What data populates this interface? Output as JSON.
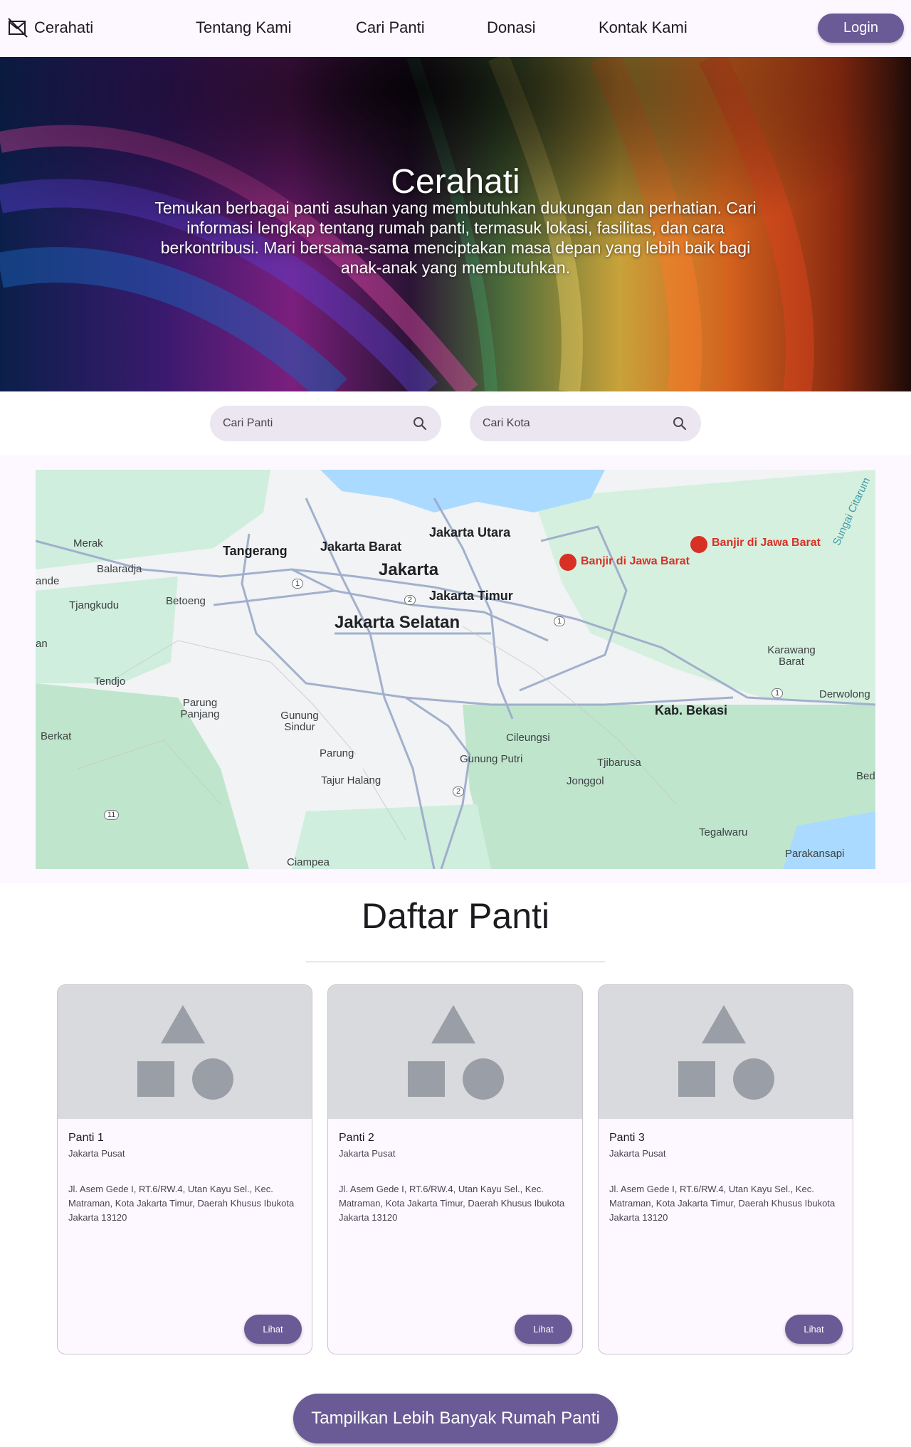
{
  "nav": {
    "brand": "Cerahati",
    "links": [
      "Tentang Kami",
      "Cari Panti",
      "Donasi",
      "Kontak Kami"
    ],
    "login_label": "Login"
  },
  "hero": {
    "title": "Cerahati",
    "description": "Temukan berbagai panti asuhan yang membutuhkan dukungan dan perhatian. Cari informasi lengkap tentang rumah panti, termasuk lokasi, fasilitas, dan cara berkontribusi. Mari bersama-sama menciptakan masa depan yang lebih baik bagi anak-anak yang membutuhkan."
  },
  "search": {
    "panti_placeholder": "Cari Panti",
    "kota_placeholder": "Cari Kota"
  },
  "map": {
    "labels": {
      "jakarta": "Jakarta",
      "jakarta_selatan": "Jakarta Selatan",
      "jakarta_barat": "Jakarta Barat",
      "jakarta_utara": "Jakarta Utara",
      "jakarta_timur": "Jakarta Timur",
      "tangerang": "Tangerang",
      "merak": "Merak",
      "balaradja": "Balaradja",
      "ande": "ande",
      "tjangkudu": "Tjangkudu",
      "betoeng": "Betoeng",
      "an": "an",
      "tendjo": "Tendjo",
      "parung_panjang": "Parung Panjang",
      "gunung_sindur": "Gunung Sindur",
      "berkat": "Berkat",
      "parung": "Parung",
      "tajur_halang": "Tajur Halang",
      "gunung_putri": "Gunung Putri",
      "cileungsi": "Cileungsi",
      "tjibarusa": "Tjibarusa",
      "jonggol": "Jonggol",
      "kab_bekasi": "Kab. Bekasi",
      "karawang_barat": "Karawang Barat",
      "derwolong": "Derwolong",
      "bed": "Bed",
      "tegalwaru": "Tegalwaru",
      "parakansapi": "Parakansapi",
      "ciampea": "Ciampea",
      "sungai_citarum": "Sungai Citarum",
      "alert_1": "Banjir di Jawa Barat",
      "alert_2": "Banjir di Jawa Barat"
    },
    "road_markers": [
      "1",
      "2",
      "1",
      "2",
      "1",
      "11"
    ]
  },
  "list": {
    "title": "Daftar Panti",
    "cards": [
      {
        "name": "Panti 1",
        "city": "Jakarta Pusat",
        "address": "Jl. Asem Gede I, RT.6/RW.4, Utan Kayu Sel., Kec. Matraman, Kota Jakarta Timur, Daerah Khusus Ibukota Jakarta 13120",
        "button": "Lihat"
      },
      {
        "name": "Panti 2",
        "city": "Jakarta Pusat",
        "address": "Jl. Asem Gede I, RT.6/RW.4, Utan Kayu Sel., Kec. Matraman, Kota Jakarta Timur, Daerah Khusus Ibukota Jakarta 13120",
        "button": "Lihat"
      },
      {
        "name": "Panti 3",
        "city": "Jakarta Pusat",
        "address": "Jl. Asem Gede I, RT.6/RW.4, Utan Kayu Sel., Kec. Matraman, Kota Jakarta Timur, Daerah Khusus Ibukota Jakarta 13120",
        "button": "Lihat"
      }
    ],
    "more_button": "Tampilkan Lebih Banyak Rumah Panti"
  },
  "colors": {
    "primary": "#6a5a96",
    "surface": "#fdf7ff",
    "search_bg": "#ebe6f0",
    "placeholder_bg": "#d9dadd"
  }
}
